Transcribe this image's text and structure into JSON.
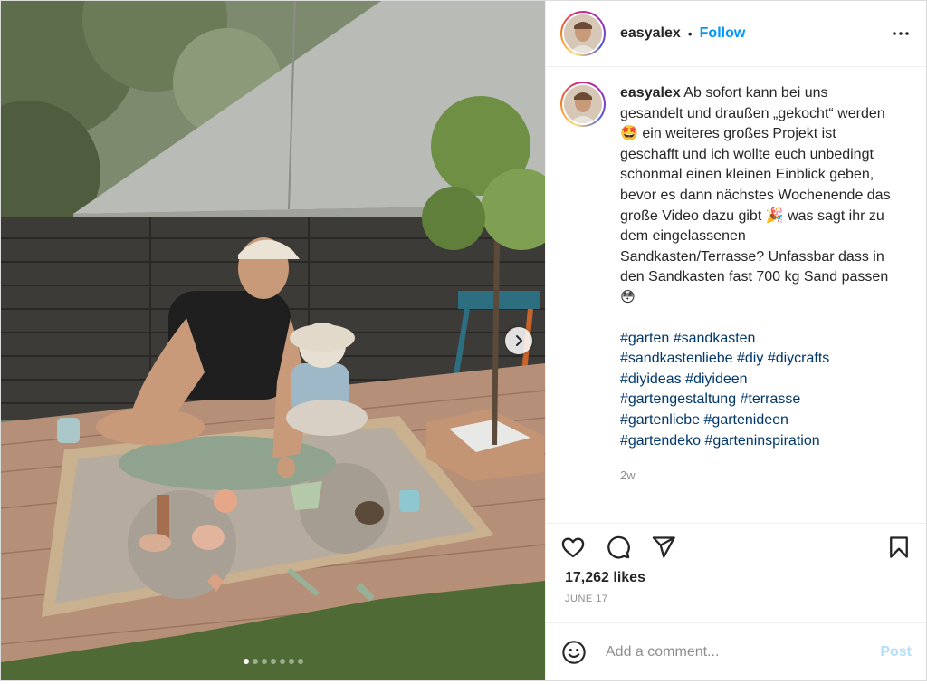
{
  "header": {
    "username": "easyalex",
    "separator": "•",
    "follow_label": "Follow",
    "more_icon": "more-horizontal-icon"
  },
  "caption": {
    "username": "easyalex",
    "text": " Ab sofort kann bei uns gesandelt und draußen „gekocht“ werden 🤩 ein weiteres großes Projekt ist geschafft und ich wollte euch unbedingt schonmal einen kleinen Einblick geben, bevor es dann nächstes Wochenende das große Video dazu gibt 🎉 was sagt ihr zu dem eingelassenen Sandkasten/Terrasse? Unfassbar dass in den Sandkasten fast 700 kg Sand passen 😳",
    "hashtags": [
      "#garten",
      "#sandkasten",
      "#sandkastenliebe",
      "#diy",
      "#diycrafts",
      "#diyideas",
      "#diyideen",
      "#gartengestaltung",
      "#terrasse",
      "#gartenliebe",
      "#gartenideen",
      "#gartendeko",
      "#garteninspiration"
    ],
    "time_ago": "2w"
  },
  "actions": {
    "like_icon": "heart-icon",
    "comment_icon": "comment-icon",
    "share_icon": "share-icon",
    "save_icon": "bookmark-icon"
  },
  "likes": "17,262 likes",
  "date": "JUNE 17",
  "comment_box": {
    "placeholder": "Add a comment...",
    "post_label": "Post",
    "emoji_icon": "emoji-icon"
  },
  "media": {
    "slide_count": 7,
    "active_slide": 1,
    "next_icon": "chevron-right-icon"
  },
  "colors": {
    "follow": "#0095f6",
    "hashtag": "#00376b",
    "post_disabled": "#b2dffc",
    "muted": "#8e8e8e"
  }
}
